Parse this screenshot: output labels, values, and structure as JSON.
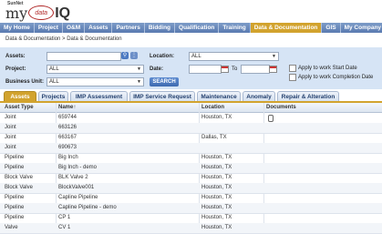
{
  "logo": {
    "brand": "SunNet",
    "my": "my",
    "mark": "data",
    "iq": "IQ"
  },
  "nav": [
    "My Home",
    "Project",
    "O&M",
    "Assets",
    "Partners",
    "Bidding",
    "Qualification",
    "Training",
    "Data & Documentation",
    "GIS",
    "My Company"
  ],
  "breadcrumb": "Data & Documentation > Data & Documentation",
  "filters": {
    "assets_label": "Assets:",
    "project_label": "Project:",
    "project_value": "ALL",
    "business_unit_label": "Business Unit:",
    "business_unit_value": "ALL",
    "location_label": "Location:",
    "location_value": "ALL",
    "date_label": "Date:",
    "date_to": "To",
    "search_button": "SEARCH",
    "apply_start": "Apply to work Start Date",
    "apply_completion": "Apply to work Completion Date"
  },
  "tabs": [
    "Assets",
    "Projects",
    "IMP Assessment",
    "IMP Service Request",
    "Maintenance",
    "Anomaly",
    "Repair & Alteration"
  ],
  "columns": [
    "Asset Type",
    "Name↑",
    "Location",
    "Documents"
  ],
  "rows": [
    {
      "type": "Joint",
      "name": "659744",
      "location": "Houston, TX",
      "doc": true
    },
    {
      "type": "Joint",
      "name": "663126",
      "location": "",
      "doc": false
    },
    {
      "type": "Joint",
      "name": "663167",
      "location": "Dallas, TX",
      "doc": false
    },
    {
      "type": "Joint",
      "name": "690673",
      "location": "",
      "doc": false
    },
    {
      "type": "Pipeline",
      "name": "Big Inch",
      "location": "Houston, TX",
      "doc": false
    },
    {
      "type": "Pipeline",
      "name": "Big Inch - demo",
      "location": "Houston, TX",
      "doc": false
    },
    {
      "type": "Block Valve",
      "name": "BLK Valve 2",
      "location": "Houston, TX",
      "doc": false
    },
    {
      "type": "Block Valve",
      "name": "BlockValve001",
      "location": "Houston, TX",
      "doc": false
    },
    {
      "type": "Pipeline",
      "name": "Capline Pipeline",
      "location": "Houston, TX",
      "doc": false
    },
    {
      "type": "Pipeline",
      "name": "Capline Pipeline - demo",
      "location": "Houston, TX",
      "doc": false
    },
    {
      "type": "Pipeline",
      "name": "CP 1",
      "location": "Houston, TX",
      "doc": false
    },
    {
      "type": "Valve",
      "name": "CV 1",
      "location": "Houston, TX",
      "doc": false
    }
  ]
}
